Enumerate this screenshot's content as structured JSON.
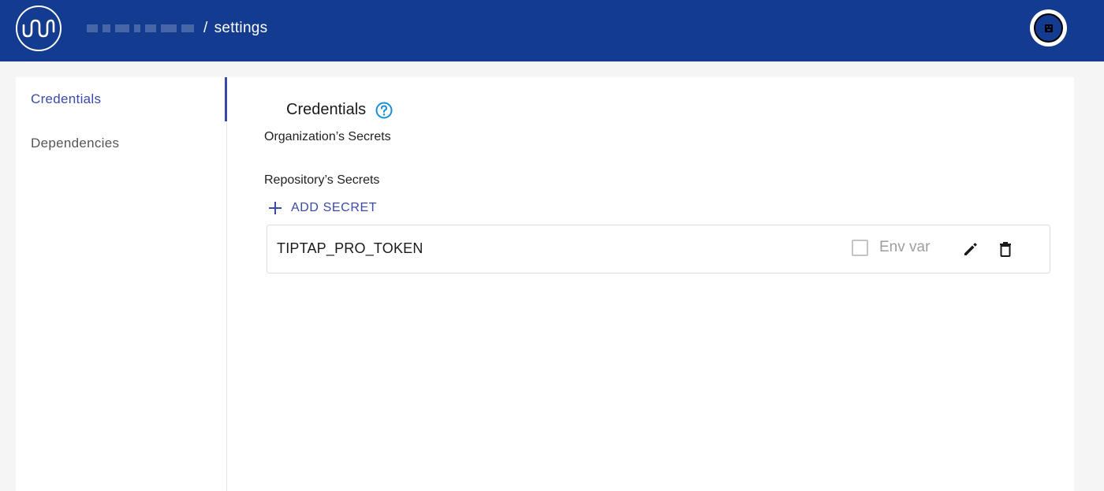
{
  "header": {
    "breadcrumb_separator": "/",
    "breadcrumb_current": "settings",
    "logo_icon": "wave-logo-icon",
    "avatar_icon": "user-avatar-icon"
  },
  "sidebar": {
    "items": [
      {
        "label": "Credentials",
        "active": true
      },
      {
        "label": "Dependencies",
        "active": false
      }
    ]
  },
  "main": {
    "title": "Credentials",
    "help_icon": "help-circle-icon",
    "org_secrets_label": "Organization’s Secrets",
    "repo_secrets_label": "Repository’s Secrets",
    "add_secret_label": "ADD SECRET",
    "secrets": [
      {
        "name": "TIPTAP_PRO_TOKEN",
        "env_var_label": "Env var",
        "env_var_checked": false
      }
    ]
  },
  "colors": {
    "header_bg": "#133b8f",
    "accent": "#3a4aa8",
    "help_icon": "#1a8fd6"
  }
}
